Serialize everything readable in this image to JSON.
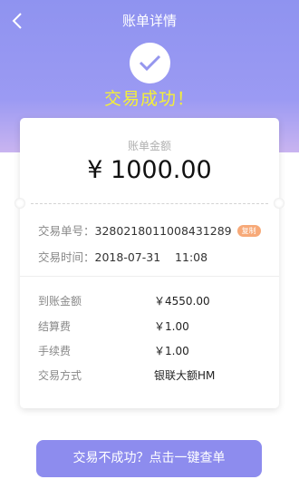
{
  "nav": {
    "title": "账单详情"
  },
  "status": {
    "text": "交易成功！"
  },
  "bill": {
    "amount_label": "账单金额",
    "amount_value": "¥ 1000.00"
  },
  "info": {
    "order_no_label": "交易单号：",
    "order_no_value": "3280218011008431289",
    "copy_label": "复制",
    "time_label": "交易时间：",
    "time_value": "2018-07-31    11:08"
  },
  "details": [
    {
      "label": "到账金额",
      "value": "￥4550.00"
    },
    {
      "label": "结算费",
      "value": "￥1.00"
    },
    {
      "label": "手续费",
      "value": "￥1.00"
    },
    {
      "label": "交易方式",
      "value": "银联大额HM"
    }
  ],
  "footer": {
    "button_label": "交易不成功？点击一键查单"
  },
  "colors": {
    "header_bg": "#9b9af3",
    "success_text": "#f4ef38",
    "button_bg": "#8d8cee",
    "copy_badge": "#f7a978"
  },
  "icons": {
    "back": "chevron-left-icon",
    "success": "checkmark-icon"
  }
}
